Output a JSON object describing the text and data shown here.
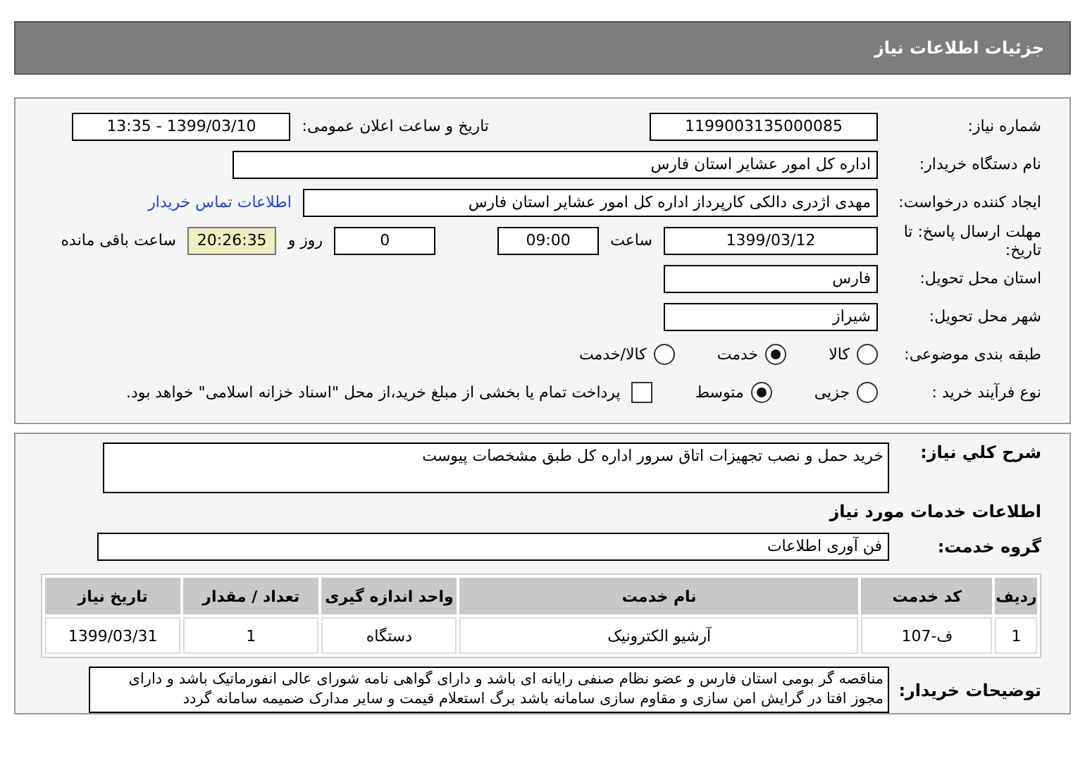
{
  "header": {
    "title": "جزئیات اطلاعات نیاز"
  },
  "need_number": {
    "label": "شماره نیاز:",
    "value": "1199003135000085"
  },
  "announce": {
    "label": "تاریخ و ساعت اعلان عمومی:",
    "value": "1399/03/10 - 13:35"
  },
  "buyer_org": {
    "label": "نام دستگاه خریدار:",
    "value": "اداره کل امور عشایر استان فارس"
  },
  "requester": {
    "label": "ایجاد کننده درخواست:",
    "value": "مهدی اژدری دالکی  کارپرداز اداره کل امور عشایر استان فارس",
    "link": "اطلاعات تماس خریدار"
  },
  "deadline": {
    "label": "مهلت ارسال پاسخ: تا تاریخ:",
    "date": "1399/03/12",
    "time_label": "ساعت",
    "time": "09:00",
    "days": "0",
    "days_label": "روز و",
    "remaining": "20:26:35",
    "remaining_label": "ساعت باقی مانده"
  },
  "province": {
    "label": "استان محل تحویل:",
    "value": "فارس"
  },
  "city": {
    "label": "شهر محل تحویل:",
    "value": "شیراز"
  },
  "category": {
    "label": "طبقه بندی موضوعی:",
    "options": [
      {
        "label": "کالا",
        "selected": false
      },
      {
        "label": "خدمت",
        "selected": true
      },
      {
        "label": "کالا/خدمت",
        "selected": false
      }
    ]
  },
  "process": {
    "label": "نوع فرآیند خرید :",
    "options": [
      {
        "label": "جزیی",
        "selected": false
      },
      {
        "label": "متوسط",
        "selected": true
      }
    ],
    "payment": {
      "label": "پرداخت تمام یا بخشی از مبلغ خرید،از محل \"اسناد خزانه اسلامی\" خواهد بود.",
      "checked": false
    }
  },
  "summary": {
    "label": "شرح کلي نياز:",
    "value": "خرید حمل و نصب تجهیزات اتاق سرور اداره کل طبق مشخصات پیوست"
  },
  "services_heading": "اطلاعات خدمات مورد نیاز",
  "service_group": {
    "label": "گروه خدمت:",
    "value": "فن آوری اطلاعات"
  },
  "table": {
    "columns": [
      "ردیف",
      "کد خدمت",
      "نام خدمت",
      "واحد اندازه گیری",
      "تعداد / مقدار",
      "تاریخ نیاز"
    ],
    "rows": [
      [
        "1",
        "ف-107",
        "آرشیو الکترونیک",
        "دستگاه",
        "1",
        "1399/03/31"
      ]
    ]
  },
  "buyer_notes": {
    "label": "توضیحات خریدار:",
    "value": "مناقصه گر بومی استان فارس و عضو نظام صنفی رایانه ای باشد و دارای گواهی نامه شورای عالی انفورماتیک باشد و دارای مجوز افتا در گرایش امن سازی و مقاوم سازی سامانه باشد برگ استعلام قیمت و سایر مدارک ضمیمه سامانه گردد"
  }
}
